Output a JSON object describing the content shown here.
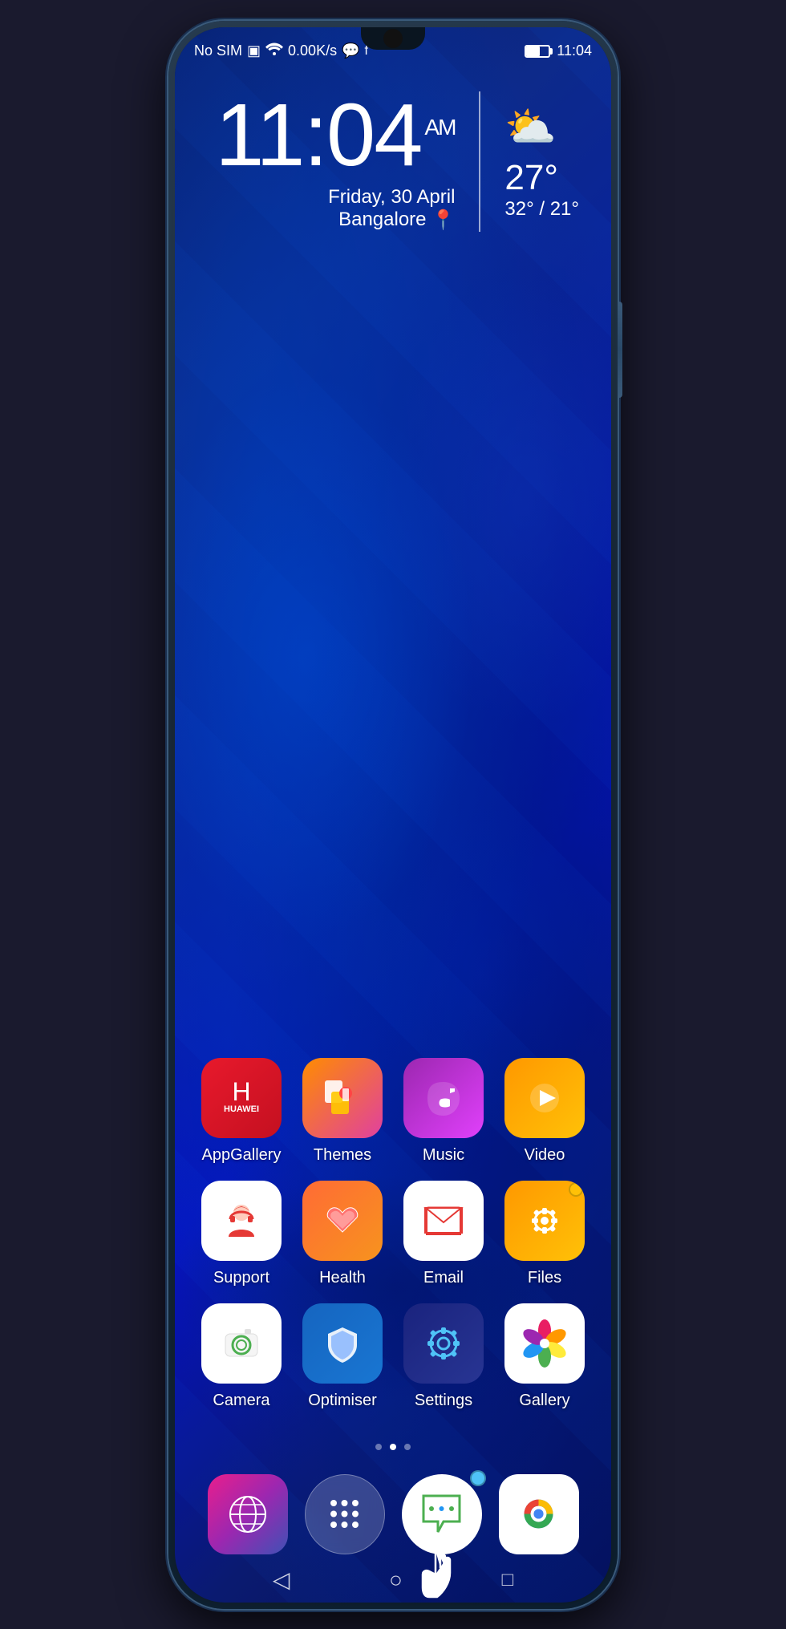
{
  "phone": {
    "status_bar": {
      "left": "No SIM",
      "speed": "0.00K/s",
      "time": "11:04",
      "battery_percent": 60
    },
    "clock": {
      "time": "11:04",
      "am_pm": "AM",
      "date": "Friday, 30 April",
      "location": "Bangalore"
    },
    "weather": {
      "temp": "27°",
      "range": "32° / 21°"
    },
    "apps": {
      "row1": [
        {
          "id": "appgallery",
          "label": "AppGallery"
        },
        {
          "id": "themes",
          "label": "Themes"
        },
        {
          "id": "music",
          "label": "Music"
        },
        {
          "id": "video",
          "label": "Video"
        }
      ],
      "row2": [
        {
          "id": "support",
          "label": "Support"
        },
        {
          "id": "health",
          "label": "Health"
        },
        {
          "id": "email",
          "label": "Email"
        },
        {
          "id": "files",
          "label": "Files"
        }
      ],
      "row3": [
        {
          "id": "camera",
          "label": "Camera"
        },
        {
          "id": "optimiser",
          "label": "Optimiser"
        },
        {
          "id": "settings",
          "label": "Settings"
        },
        {
          "id": "gallery",
          "label": "Gallery"
        }
      ]
    },
    "dock": [
      {
        "id": "browser",
        "label": "Browser"
      },
      {
        "id": "allapps",
        "label": "All Apps"
      },
      {
        "id": "messages",
        "label": "Messages"
      },
      {
        "id": "chrome",
        "label": "Chrome"
      }
    ],
    "page_dots": [
      false,
      true,
      false
    ],
    "nav": {
      "back": "◁",
      "home": "○",
      "recent": "□"
    }
  }
}
